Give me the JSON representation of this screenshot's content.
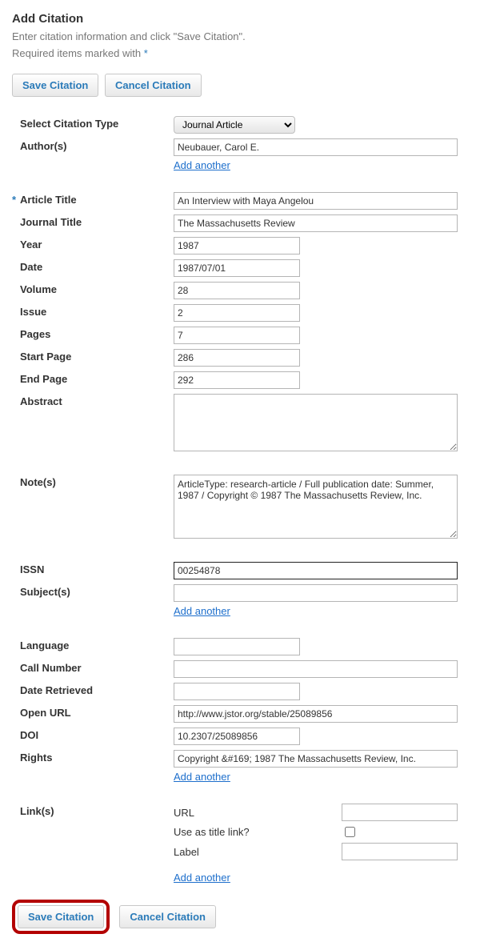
{
  "page": {
    "title": "Add Citation",
    "intro": "Enter citation information and click \"Save Citation\".",
    "required_note_prefix": "Required items marked with ",
    "required_marker": "*"
  },
  "buttons": {
    "save": "Save Citation",
    "cancel": "Cancel Citation"
  },
  "links": {
    "add_another": "Add another"
  },
  "labels": {
    "citation_type": "Select Citation Type",
    "authors": "Author(s)",
    "article_title": "Article Title",
    "journal_title": "Journal Title",
    "year": "Year",
    "date": "Date",
    "volume": "Volume",
    "issue": "Issue",
    "pages": "Pages",
    "start_page": "Start Page",
    "end_page": "End Page",
    "abstract": "Abstract",
    "notes": "Note(s)",
    "issn": "ISSN",
    "subjects": "Subject(s)",
    "language": "Language",
    "call_number": "Call Number",
    "date_retrieved": "Date Retrieved",
    "open_url": "Open URL",
    "doi": "DOI",
    "rights": "Rights",
    "links": "Link(s)",
    "url": "URL",
    "use_as_title": "Use as title link?",
    "link_label": "Label"
  },
  "values": {
    "citation_type": "Journal Article",
    "authors": "Neubauer, Carol E.",
    "article_title": "An Interview with Maya Angelou",
    "journal_title": "The Massachusetts Review",
    "year": "1987",
    "date": "1987/07/01",
    "volume": "28",
    "issue": "2",
    "pages": "7",
    "start_page": "286",
    "end_page": "292",
    "abstract": "",
    "notes": "ArticleType: research-article / Full publication date: Summer, 1987 / Copyright © 1987 The Massachusetts Review, Inc.",
    "issn": "00254878",
    "subjects": "",
    "language": "",
    "call_number": "",
    "date_retrieved": "",
    "open_url": "http://www.jstor.org/stable/25089856",
    "doi": "10.2307/25089856",
    "rights": "Copyright &#169; 1987 The Massachusetts Review, Inc.",
    "link_url": "",
    "link_use_title": false,
    "link_label": ""
  }
}
